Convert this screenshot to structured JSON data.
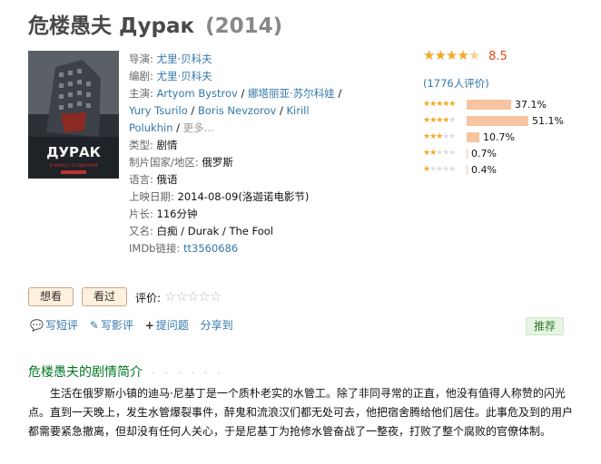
{
  "title": {
    "zh": "危楼愚夫",
    "ru": "Дурак",
    "year": "(2014)"
  },
  "poster": {
    "title_text": "ДУРАК",
    "date_text": "В КИНО С 11 ДЕКАБРЯ"
  },
  "info": {
    "director_label": "导演:",
    "director": "尤里·贝科夫",
    "writer_label": "编剧:",
    "writer": "尤里·贝科夫",
    "cast_label": "主演:",
    "cast": [
      "Artyom Bystrov",
      "娜塔丽亚·苏尔科娃",
      "Yury Tsurilo",
      "Boris Nevzorov",
      "Kirill Polukhin"
    ],
    "cast_more": "更多...",
    "genre_label": "类型:",
    "genre": "剧情",
    "country_label": "制片国家/地区:",
    "country": "俄罗斯",
    "language_label": "语言:",
    "language": "俄语",
    "release_label": "上映日期:",
    "release": "2014-08-09(洛迦诺电影节)",
    "runtime_label": "片长:",
    "runtime": "116分钟",
    "aka_label": "又名:",
    "aka": "白痴 / Durak / The Fool",
    "imdb_label": "IMDb链接:",
    "imdb": "tt3560686"
  },
  "rating": {
    "score": "8.5",
    "votes": "(1776人评价)",
    "distribution": [
      {
        "stars": 5,
        "pct": "37.1%",
        "value": 37.1
      },
      {
        "stars": 4,
        "pct": "51.1%",
        "value": 51.1
      },
      {
        "stars": 3,
        "pct": "10.7%",
        "value": 10.7
      },
      {
        "stars": 2,
        "pct": "0.7%",
        "value": 0.7
      },
      {
        "stars": 1,
        "pct": "0.4%",
        "value": 0.4
      }
    ]
  },
  "buttons": {
    "want": "想看",
    "seen": "看过",
    "rate_label": "评价:"
  },
  "actions": {
    "short_review": "写短评",
    "review": "写影评",
    "ask": "提问题",
    "share": "分享到",
    "recommend": "推荐"
  },
  "summary": {
    "heading": "危楼愚夫的剧情简介",
    "dots": "· · · · · ·",
    "text": "生活在俄罗斯小镇的迪马·尼基丁是一个质朴老实的水管工。除了非同寻常的正直，他没有值得人称赞的闪光点。直到一天晚上，发生水管爆裂事件，醉鬼和流浪汉们都无处可去，他把宿舍腾给他们居住。此事危及到的用户都需要紧急撤离，但却没有任何人关心，于是尼基丁为抢修水管奋战了一整夜，打败了整个腐败的官僚体制。"
  },
  "colors": {
    "link": "#3377aa",
    "star": "#f5a623",
    "score": "#e0451a",
    "heading": "#007722",
    "bar": "#f7c5a0"
  }
}
